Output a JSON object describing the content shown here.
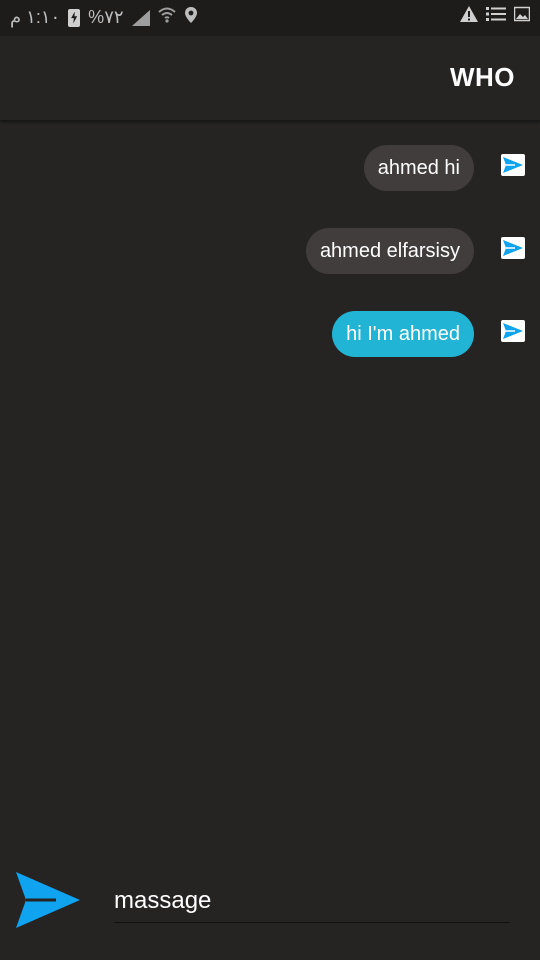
{
  "status_bar": {
    "time": "١:١٠ م",
    "battery_percent": "%٧٢"
  },
  "header": {
    "title": "WHO"
  },
  "messages": [
    {
      "text": "ahmed hi",
      "highlighted": false
    },
    {
      "text": "ahmed elfarsisy",
      "highlighted": false
    },
    {
      "text": "hi I'm ahmed",
      "highlighted": true
    }
  ],
  "composer": {
    "value": "massage",
    "placeholder": ""
  },
  "colors": {
    "background": "#252423",
    "bubble": "#403d3c",
    "bubble_highlight": "#22b4d4",
    "send_accent": "#0fa3f0"
  },
  "icons": [
    "send-icon",
    "warning-icon",
    "list-icon",
    "image-icon",
    "location-icon",
    "wifi-icon",
    "signal-icon",
    "battery-icon"
  ]
}
